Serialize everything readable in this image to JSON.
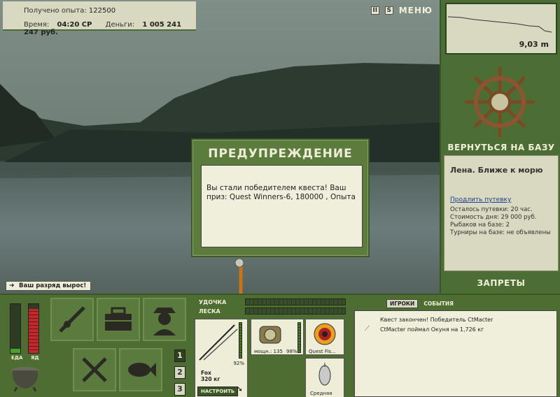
{
  "hud": {
    "exp_label": "Получено опыта:",
    "exp_value": "122500",
    "time_label": "Время:",
    "time_value": "04:20 СР",
    "money_label": "Деньги:",
    "money_value": "1 005 241 247 руб."
  },
  "topbar": {
    "pause_label": "II",
    "sound_label": "S",
    "menu_label": "МЕНЮ"
  },
  "depth": {
    "value": "9,03 m"
  },
  "right_panel": {
    "back_to_base": "ВЕРНУТЬСЯ НА БАЗУ",
    "location_title": "Лена. Ближе к морю",
    "extend_link": "Продлить путевку",
    "lines": [
      "Осталось путевки: 20 час.",
      "Стоимость дня: 29 000 руб.",
      "Рыбаков на базе: 2",
      "Турниры на базе: не объявлены"
    ],
    "bans": "ЗАПРЕТЫ"
  },
  "dialog": {
    "title": "ПРЕДУПРЕЖДЕНИЕ",
    "text": "Вы стали победителем квеста! Ваш приз: Quest Winners-6, 180000 , Опыта"
  },
  "notice": "Ваш разряд вырос!",
  "meters": {
    "food_label": "ЕДА",
    "energy_label": "ЯД",
    "food_level": 0.08,
    "energy_level": 0.9,
    "food_color": "#4aa02a",
    "energy_color": "#c02a2a"
  },
  "slots": {
    "pages": [
      "1",
      "2",
      "3"
    ],
    "active_page": "1"
  },
  "tackle": {
    "rod_label": "УДОЧКА",
    "line_label": "ЛЕСКА",
    "rod_name": "Fox",
    "rod_weight": "320 кг",
    "rod_pct": "92%",
    "reel_power": "мощн.: 135",
    "reel_pct": "98%",
    "line_name": "Quest Fis...",
    "lure_name": "Средняя",
    "setup_button": "НАСТРОИТЬ"
  },
  "chat": {
    "tab_players": "ИГРОКИ",
    "tab_events": "СОБЫТИЯ",
    "messages": [
      "Квест закончен! Победитель CtMacter",
      "CtMacter поймал Окуня на 1,726 кг"
    ]
  }
}
